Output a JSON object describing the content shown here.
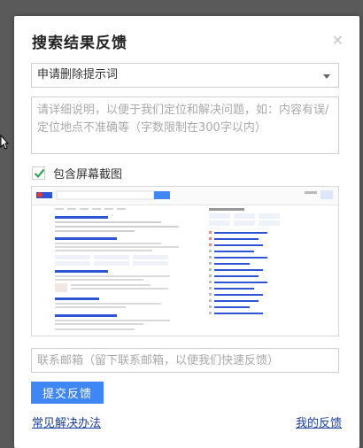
{
  "dialog": {
    "title": "搜索结果反馈",
    "close_icon": "close-icon"
  },
  "reason_select": {
    "selected": "申请删除提示词",
    "icon": "chevron-down-icon"
  },
  "description": {
    "placeholder": "请详细说明，以便于我们定位和解决问题，如：内容有误/定位地点不准确等（字数限制在300字以内）"
  },
  "screenshot_option": {
    "checked": true,
    "label": "包含屏幕截图"
  },
  "email": {
    "placeholder": "联系邮箱（留下联系邮箱，以便我们快速反馈）"
  },
  "submit_label": "提交反馈",
  "links": {
    "faq": "常见解决办法",
    "my_feedback": "我的反馈"
  },
  "colors": {
    "accent": "#3e87f5",
    "link": "#1a3fa0",
    "check": "#2fa84f"
  }
}
